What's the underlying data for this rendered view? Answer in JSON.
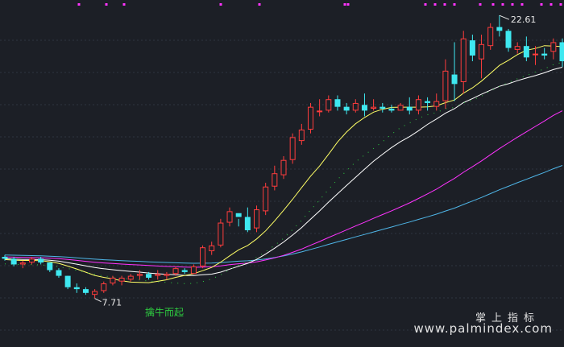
{
  "watermark": {
    "cn": "掌上指标",
    "url": "www.palmindex.com"
  },
  "chart_data": {
    "type": "candlestick",
    "ylim": [
      6.0,
      23.0
    ],
    "grid": "horizontal dashed",
    "colors": {
      "up": "#ff3d3d",
      "down": "#3fe8f0",
      "ma_short": "#ffff66",
      "ma_mid": "#ffffff",
      "ma_long": "#ff33ff",
      "ma_longer": "#4fb6e8",
      "dotted": "#2ecc40",
      "marker": "#ff33ff",
      "signal": "#2ecc40"
    },
    "annotations": {
      "high": "22.61",
      "low": "7.71",
      "signal": "擒牛而起"
    },
    "candles": [
      [
        9.9,
        10.0,
        9.7,
        9.8
      ],
      [
        9.8,
        9.9,
        9.4,
        9.5
      ],
      [
        9.5,
        9.7,
        9.3,
        9.6
      ],
      [
        9.6,
        9.9,
        9.5,
        9.8
      ],
      [
        9.8,
        9.9,
        9.5,
        9.6
      ],
      [
        9.6,
        9.6,
        9.1,
        9.2
      ],
      [
        9.2,
        9.3,
        8.8,
        8.9
      ],
      [
        8.9,
        8.9,
        8.2,
        8.3
      ],
      [
        8.3,
        8.5,
        8.0,
        8.2
      ],
      [
        8.2,
        8.3,
        7.9,
        8.0
      ],
      [
        7.9,
        8.2,
        7.71,
        8.1
      ],
      [
        8.1,
        8.6,
        8.0,
        8.5
      ],
      [
        8.5,
        8.9,
        8.4,
        8.8
      ],
      [
        8.6,
        8.9,
        8.4,
        8.8
      ],
      [
        8.7,
        9.0,
        8.6,
        8.9
      ],
      [
        8.9,
        9.2,
        8.7,
        9.0
      ],
      [
        9.0,
        9.1,
        8.7,
        8.8
      ],
      [
        8.9,
        9.2,
        8.7,
        9.0
      ],
      [
        8.9,
        9.1,
        8.7,
        9.0
      ],
      [
        9.0,
        9.4,
        8.9,
        9.3
      ],
      [
        9.2,
        9.3,
        9.0,
        9.1
      ],
      [
        9.0,
        9.5,
        9.0,
        9.4
      ],
      [
        9.4,
        10.5,
        9.3,
        10.4
      ],
      [
        10.2,
        10.7,
        10.0,
        10.5
      ],
      [
        10.5,
        11.9,
        10.4,
        11.7
      ],
      [
        11.7,
        12.5,
        11.5,
        12.3
      ],
      [
        12.2,
        11.9,
        11.5,
        12.0
      ],
      [
        12.0,
        12.5,
        11.2,
        11.3
      ],
      [
        11.4,
        12.6,
        11.2,
        12.4
      ],
      [
        12.3,
        13.8,
        12.1,
        13.6
      ],
      [
        13.6,
        14.7,
        13.4,
        14.3
      ],
      [
        14.2,
        15.2,
        14.0,
        15.0
      ],
      [
        15.0,
        16.4,
        14.8,
        16.2
      ],
      [
        16.0,
        16.9,
        15.8,
        16.6
      ],
      [
        16.6,
        18.0,
        16.4,
        17.8
      ],
      [
        17.6,
        18.2,
        17.3,
        17.6
      ],
      [
        17.6,
        18.4,
        17.5,
        18.2
      ],
      [
        18.2,
        18.4,
        17.6,
        17.8
      ],
      [
        17.8,
        18.0,
        17.4,
        17.6
      ],
      [
        17.6,
        18.2,
        17.5,
        18.0
      ],
      [
        17.9,
        18.5,
        17.3,
        17.6
      ],
      [
        17.7,
        18.2,
        17.6,
        17.8
      ],
      [
        17.8,
        18.0,
        17.5,
        17.7
      ],
      [
        17.7,
        17.9,
        17.5,
        17.6
      ],
      [
        17.6,
        18.0,
        17.6,
        17.9
      ],
      [
        17.8,
        18.3,
        17.4,
        17.6
      ],
      [
        17.6,
        18.4,
        17.4,
        18.2
      ],
      [
        18.1,
        18.3,
        17.6,
        18.0
      ],
      [
        17.8,
        18.5,
        17.6,
        18.1
      ],
      [
        18.1,
        20.3,
        17.7,
        19.7
      ],
      [
        19.5,
        21.2,
        18.1,
        19.0
      ],
      [
        19.1,
        21.8,
        18.5,
        21.4
      ],
      [
        21.3,
        21.6,
        20.2,
        20.5
      ],
      [
        20.3,
        21.6,
        19.3,
        21.1
      ],
      [
        21.0,
        22.2,
        20.8,
        22.0
      ],
      [
        22.0,
        22.61,
        21.5,
        21.8
      ],
      [
        21.8,
        21.9,
        20.7,
        20.9
      ],
      [
        20.8,
        21.2,
        20.6,
        21.0
      ],
      [
        21.0,
        21.5,
        20.2,
        20.4
      ],
      [
        20.6,
        21.0,
        20.0,
        20.6
      ],
      [
        20.6,
        20.9,
        20.3,
        20.5
      ],
      [
        20.7,
        21.4,
        20.3,
        21.2
      ],
      [
        21.2,
        21.4,
        19.9,
        20.2
      ]
    ]
  }
}
